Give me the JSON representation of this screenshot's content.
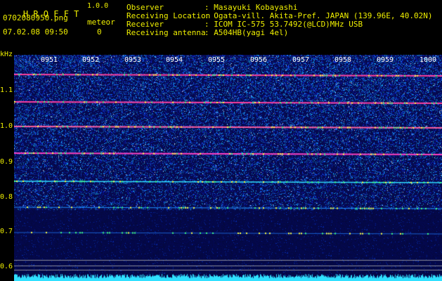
{
  "app": {
    "title": "H R O F F T",
    "version": "1.0.0",
    "filename": "0702080950.png",
    "datetime": "07.02.08 09:50",
    "meteor_label": "meteor",
    "meteor_count": "0"
  },
  "info": {
    "observer_label": "Observer",
    "observer_value": ": Masayuki Kobayashi",
    "location_label": "Receiving Location",
    "location_value": ": Ogata-vill. Akita-Pref. JAPAN (139.96E, 40.02N)",
    "receiver_label": "Receiver",
    "receiver_value": ": ICOM IC-575 53.7492(@LCD)MHz USB",
    "antenna_label": "Receiving antenna",
    "antenna_value": ": A504HB(yagi 4el)"
  },
  "axis": {
    "unit": "kHz",
    "y_ticks": [
      "1.1",
      "1.0",
      "0.9",
      "0.8",
      "0.7",
      "0.6"
    ],
    "time_ticks": [
      "0951",
      "0952",
      "0953",
      "0954",
      "0955",
      "0956",
      "0957",
      "0958",
      "0959",
      "1000"
    ]
  },
  "colors": {
    "header_yellow": "#f0f000",
    "header_green": "#22ff22",
    "background": "#000000",
    "spectrum_bg": "#0a0f5a",
    "signal_line": "#ff40a0",
    "noise_cyan": "#30e0ff"
  }
}
